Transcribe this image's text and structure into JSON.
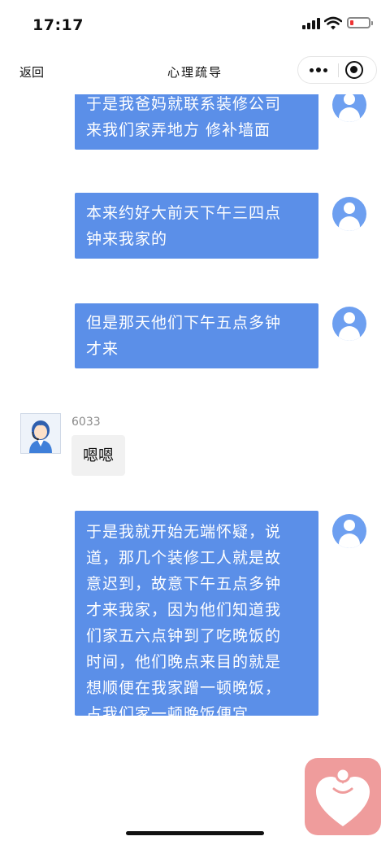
{
  "status_bar": {
    "time": "17:17"
  },
  "nav": {
    "back_label": "返回",
    "title": "心理疏导"
  },
  "messages": [
    {
      "side": "right",
      "text": "于是我爸妈就联系装修公司来我们家弄地方 修补墙面"
    },
    {
      "side": "right",
      "text": "本来约好大前天下午三四点钟来我家的"
    },
    {
      "side": "right",
      "text": "但是那天他们下午五点多钟才来"
    },
    {
      "side": "left",
      "sender": "6033",
      "text": "嗯嗯"
    },
    {
      "side": "right",
      "text": "于是我就开始无端怀疑，说道，那几个装修工人就是故意迟到，故意下午五点多钟才来我家，因为他们知道我们家五六点钟到了吃晚饭的时间，他们晚点来目的就是想顺便在我家蹭一顿晚饭，占我们家一顿晚饭便宜"
    }
  ],
  "bubble_lines": {
    "m0": [
      "于是我爸妈就联系装修公司",
      "来我们家弄地方 修补墙面"
    ],
    "m1": [
      "本来约好大前天下午三四点",
      "钟来我家的"
    ],
    "m2": [
      "但是那天他们下午五点多钟",
      "才来"
    ],
    "m4": [
      "于是我就开始无端怀疑，说",
      "道，那几个装修工人就是故",
      "意迟到，故意下午五点多钟",
      "才来我家，因为他们知道我",
      "们家五六点钟到了吃晚饭的",
      "时间，他们晚点来目的就是",
      "想顺便在我家蹭一顿晚饭，",
      "占我们家一顿晚饭便宜"
    ]
  },
  "colors": {
    "user_bubble": "#5b8fe8",
    "user_avatar": "#6d9ff0",
    "counselor_bubble": "#f1f1f1",
    "heart_button": "#ef9c9c",
    "battery_low": "#ee3333"
  },
  "icons": {
    "back": "back-text",
    "more": "more-dots-icon",
    "close": "target-close-icon",
    "user_avatar": "user-avatar-icon",
    "counselor_avatar": "counselor-avatar-icon",
    "heart_app": "heart-person-icon"
  }
}
